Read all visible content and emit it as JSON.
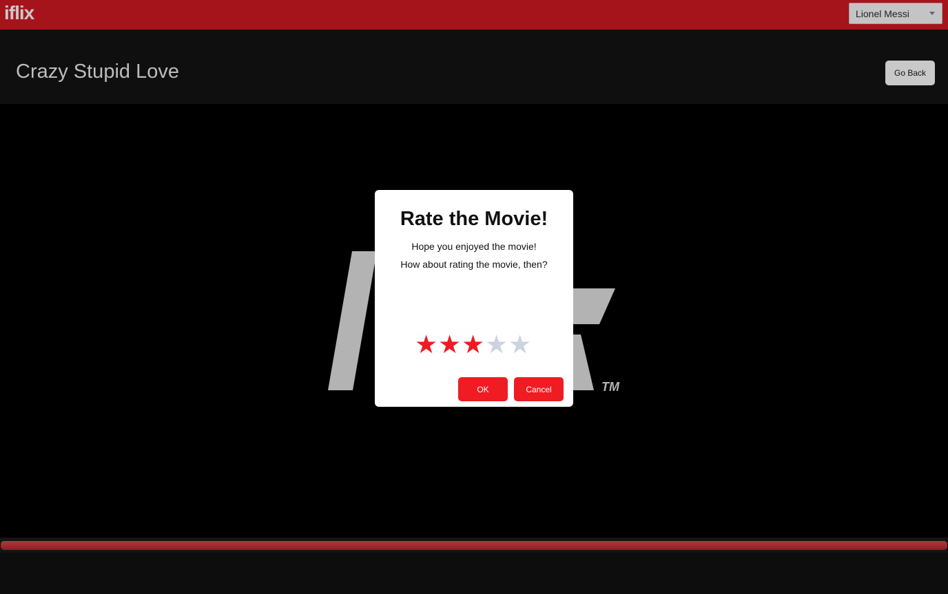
{
  "app": {
    "brand": "iflix"
  },
  "user_select": {
    "selected": "Lionel Messi",
    "icon": "chevron-down-icon"
  },
  "header": {
    "title": "Crazy Stupid Love",
    "go_back_label": "Go Back"
  },
  "player": {
    "watermark_letters": "iflix",
    "watermark_tm": "TM",
    "progress": 1.0
  },
  "modal": {
    "title": "Rate the Movie!",
    "line1": "Hope you enjoyed the movie!",
    "line2": "How about rating the movie, then?",
    "rating": 3,
    "max_rating": 5,
    "star_glyph": "★",
    "ok_label": "OK",
    "cancel_label": "Cancel"
  },
  "colors": {
    "topbar": "#a6141b",
    "accent": "#ef1c23",
    "star_on": "#ed1c24",
    "star_off": "#ccd3e0",
    "watermark": "#b3b3b3"
  }
}
